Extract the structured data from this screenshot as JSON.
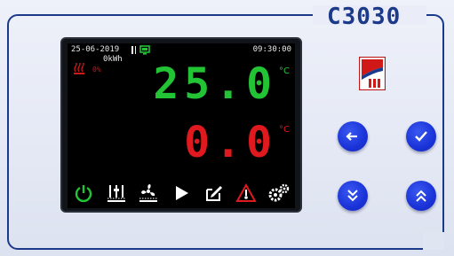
{
  "device": {
    "model": "C3030"
  },
  "screen": {
    "date": "25-06-2019",
    "time": "09:30:00",
    "energy": "0kWh",
    "heater_percent": "0%",
    "temperature_main": "25.0",
    "temperature_set": "0.0",
    "unit": "°C"
  },
  "colors": {
    "frame": "#1c3a8a",
    "button": "#1a33d8",
    "temp_main": "#22c335",
    "temp_set": "#e0191f"
  },
  "toolbar": {
    "icons": [
      "power-icon",
      "sliders-icon",
      "fan-icon",
      "play-icon",
      "edit-icon",
      "alarm-warning-icon",
      "settings-gears-icon"
    ]
  },
  "buttons": {
    "back": "arrow-left-icon",
    "ok": "check-icon",
    "down": "double-chevron-down-icon",
    "up": "double-chevron-up-icon"
  }
}
